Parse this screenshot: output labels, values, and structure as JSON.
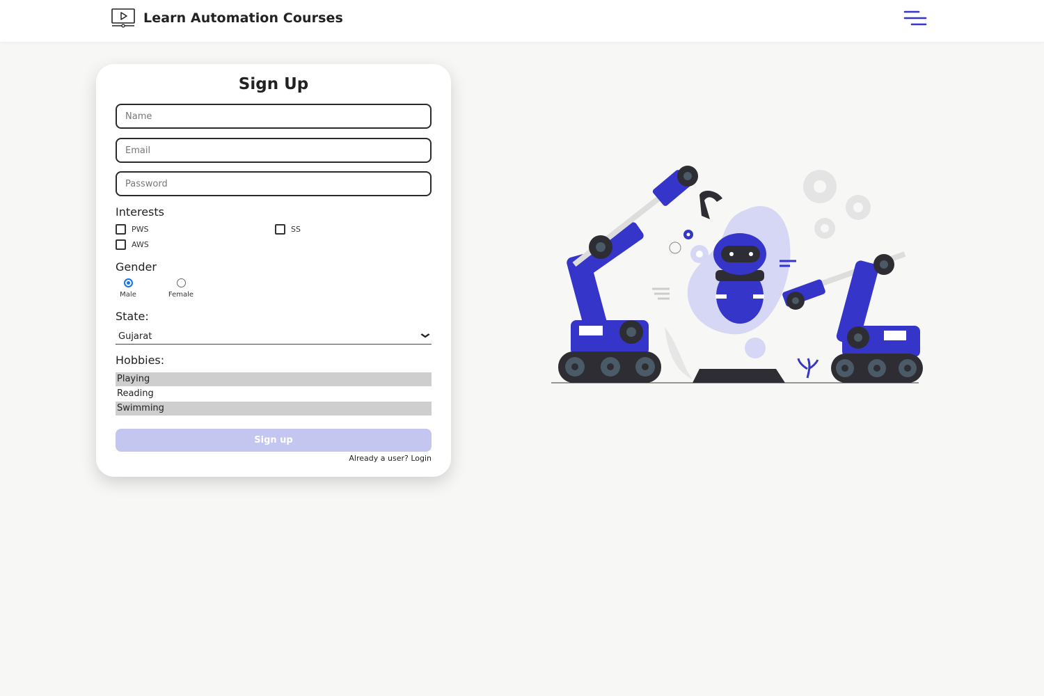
{
  "header": {
    "brand_title": "Learn Automation Courses",
    "logo_icon": "video-monitor-icon",
    "menu_icon": "hamburger-menu-icon"
  },
  "form": {
    "title": "Sign Up",
    "name_placeholder": "Name",
    "email_placeholder": "Email",
    "password_placeholder": "Password",
    "interests_label": "Interests",
    "interests": [
      {
        "label": "PWS",
        "checked": false
      },
      {
        "label": "SS",
        "checked": false
      },
      {
        "label": "AWS",
        "checked": false
      }
    ],
    "gender_label": "Gender",
    "genders": [
      {
        "label": "Male",
        "selected": true
      },
      {
        "label": "Female",
        "selected": false
      }
    ],
    "state_label": "State:",
    "state_value": "Gujarat",
    "hobbies_label": "Hobbies:",
    "hobbies": [
      {
        "label": "Playing",
        "selected": true
      },
      {
        "label": "Reading",
        "selected": false
      },
      {
        "label": "Swimming",
        "selected": true
      }
    ],
    "submit_label": "Sign up",
    "login_text": "Already a user? Login"
  },
  "colors": {
    "accent": "#3535c9",
    "button_disabled": "#c4c6ef",
    "radio_selected": "#1a73e8"
  }
}
